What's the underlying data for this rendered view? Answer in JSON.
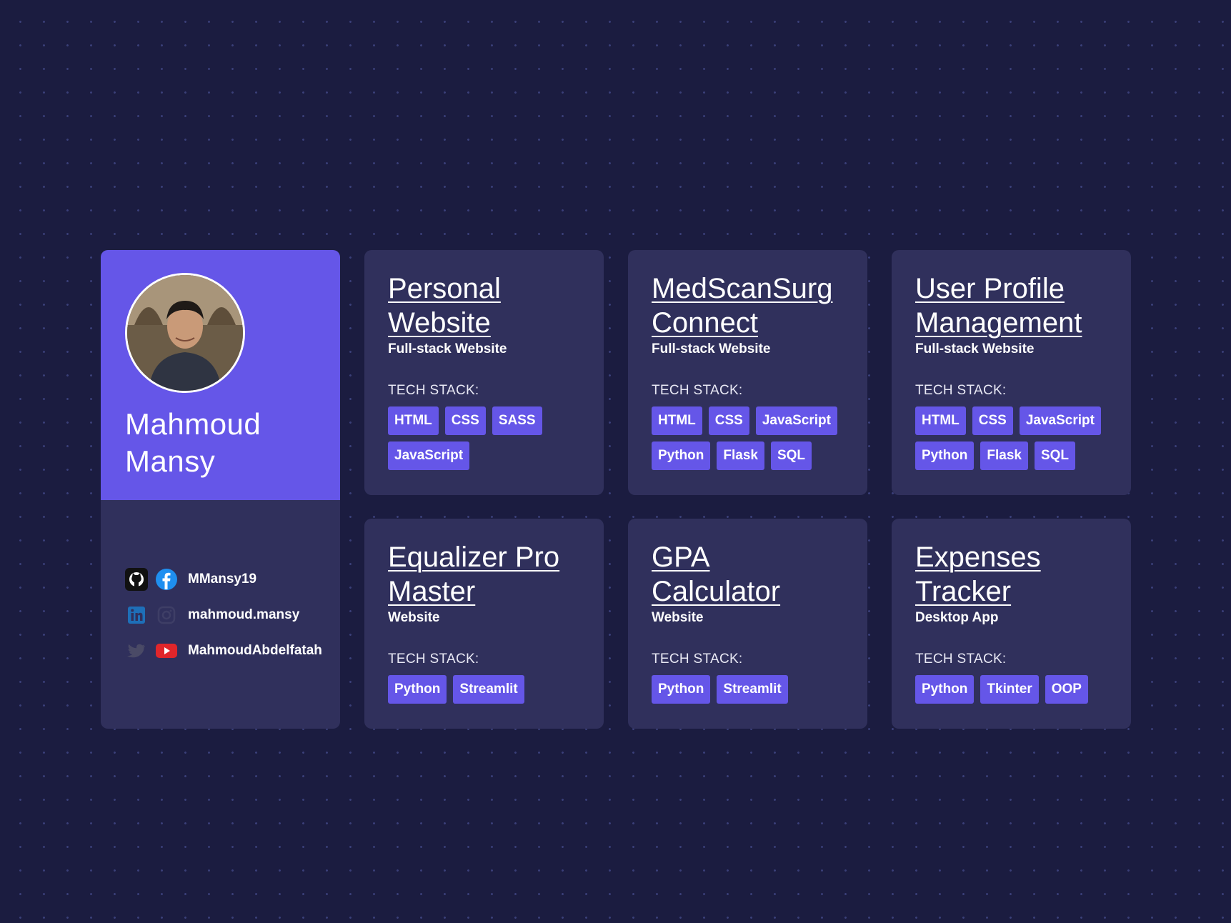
{
  "profile": {
    "name_line1": "Mahmoud",
    "name_line2": "Mansy",
    "socials": [
      {
        "icons": [
          "github-icon",
          "facebook-icon"
        ],
        "handle": "MMansy19"
      },
      {
        "icons": [
          "linkedin-icon",
          "instagram-icon"
        ],
        "handle": "mahmoud.mansy"
      },
      {
        "icons": [
          "twitter-icon",
          "youtube-icon"
        ],
        "handle": "MahmoudAbdelfatah"
      }
    ]
  },
  "stack_label": "TECH STACK:",
  "projects": [
    {
      "title": "Personal Website",
      "type": "Full-stack Website",
      "tags": [
        "HTML",
        "CSS",
        "SASS",
        "JavaScript"
      ]
    },
    {
      "title": "MedScanSurg Connect",
      "type": "Full-stack Website",
      "tags": [
        "HTML",
        "CSS",
        "JavaScript",
        "Python",
        "Flask",
        "SQL"
      ]
    },
    {
      "title": "User Profile Management",
      "type": "Full-stack Website",
      "tags": [
        "HTML",
        "CSS",
        "JavaScript",
        "Python",
        "Flask",
        "SQL"
      ]
    },
    {
      "title": "Equalizer Pro Master",
      "type": "Website",
      "tags": [
        "Python",
        "Streamlit"
      ]
    },
    {
      "title": "GPA Calculator",
      "type": "Website",
      "tags": [
        "Python",
        "Streamlit"
      ]
    },
    {
      "title": "Expenses Tracker",
      "type": "Desktop App",
      "tags": [
        "Python",
        "Tkinter",
        "OOP"
      ]
    }
  ],
  "colors": {
    "background": "#1b1c40",
    "card": "#30305c",
    "accent": "#6556e8"
  }
}
